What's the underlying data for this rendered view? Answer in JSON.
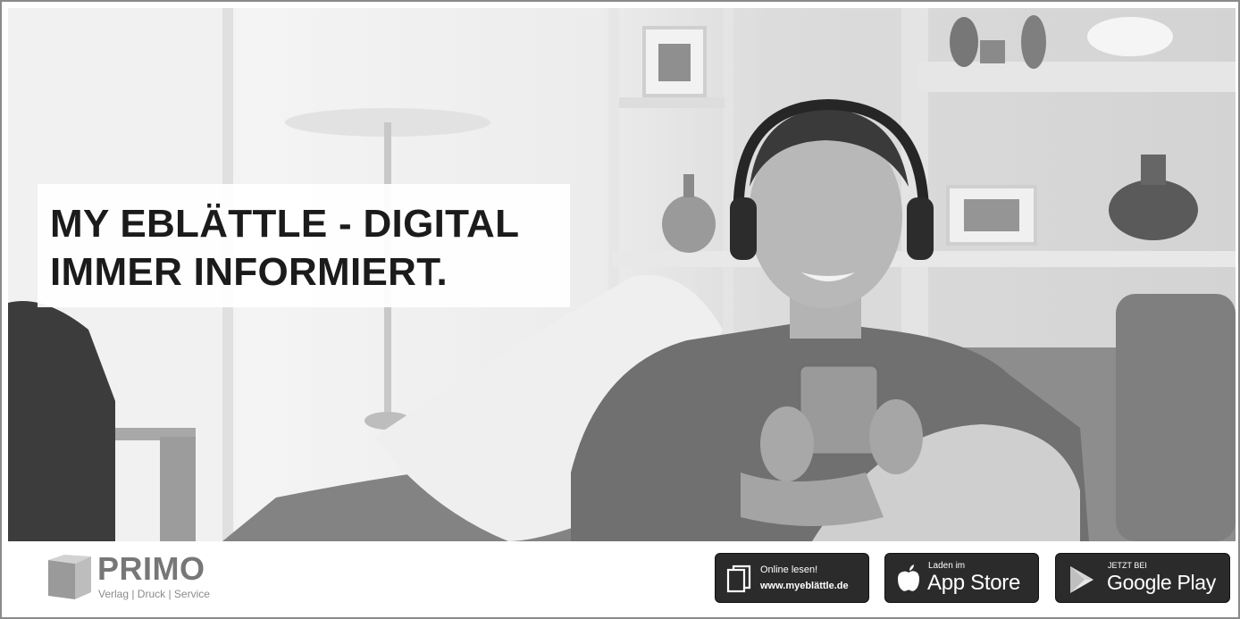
{
  "headline": {
    "line1": "MY EBLÄTTLE - DIGITAL",
    "line2": "IMMER INFORMIERT."
  },
  "logo": {
    "name": "PRIMO",
    "tagline": "Verlag | Druck | Service"
  },
  "badges": {
    "online": {
      "line1": "Online lesen!",
      "line2": "www.myeblättle.de",
      "icon": "book-icon"
    },
    "appstore": {
      "line1": "Laden im",
      "line2": "App Store",
      "icon": "apple-icon"
    },
    "gplay": {
      "line1": "JETZT BEI",
      "line2": "Google Play",
      "icon": "play-icon"
    }
  },
  "colors": {
    "badge_background": "#2b2b2b",
    "headline_text": "#1b1b1b",
    "logo_gray": "#777777"
  }
}
